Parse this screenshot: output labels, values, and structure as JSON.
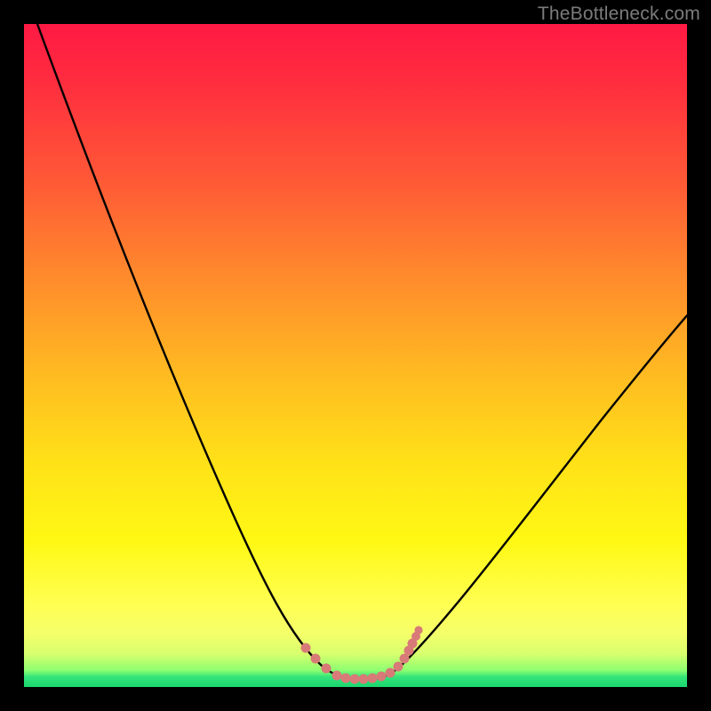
{
  "watermark": "TheBottleneck.com",
  "chart_data": {
    "type": "line",
    "title": "",
    "xlabel": "",
    "ylabel": "",
    "xlim": [
      0,
      100
    ],
    "ylim": [
      0,
      100
    ],
    "grid": false,
    "legend": false,
    "background_gradient": {
      "direction": "vertical",
      "stops": [
        {
          "pos": 0,
          "color": "#ff1a44"
        },
        {
          "pos": 0.24,
          "color": "#ff5a36"
        },
        {
          "pos": 0.52,
          "color": "#ffb822"
        },
        {
          "pos": 0.78,
          "color": "#fff814"
        },
        {
          "pos": 0.95,
          "color": "#d8ff6e"
        },
        {
          "pos": 1.0,
          "color": "#19d86f"
        }
      ]
    },
    "series": [
      {
        "name": "bottleneck-curve",
        "color": "#000000",
        "x": [
          2,
          6,
          10,
          14,
          18,
          22,
          26,
          30,
          34,
          38,
          41,
          44,
          47,
          50,
          53,
          55,
          57,
          60,
          64,
          68,
          72,
          76,
          80,
          84,
          88,
          92,
          96,
          100
        ],
        "y": [
          100,
          90,
          80,
          71,
          62,
          54,
          46,
          39,
          32,
          25,
          19,
          13,
          8,
          4,
          2,
          1,
          1,
          2,
          6,
          12,
          18,
          24,
          30,
          36,
          41,
          46,
          51,
          56
        ]
      },
      {
        "name": "bottom-markers",
        "type": "scatter",
        "color": "#d87a78",
        "x": [
          42,
          44,
          46,
          48,
          50,
          52,
          54,
          56,
          57,
          58,
          58.5,
          59,
          59.5
        ],
        "y": [
          5,
          3.5,
          2.2,
          1.4,
          1,
          1,
          1.2,
          1.8,
          2.5,
          4,
          5.5,
          7,
          8.5
        ]
      }
    ]
  }
}
